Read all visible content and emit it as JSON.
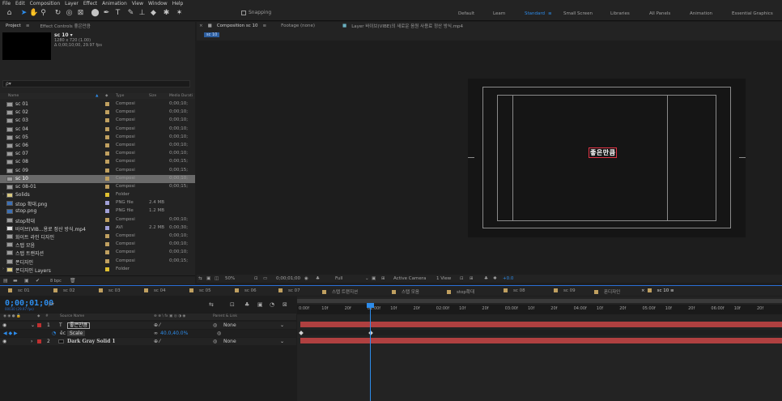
{
  "menu": [
    "File",
    "Edit",
    "Composition",
    "Layer",
    "Effect",
    "Animation",
    "View",
    "Window",
    "Help"
  ],
  "toolbar": {
    "snapping_label": "Snapping",
    "workspaces": [
      "Default",
      "Learn",
      "Standard",
      "Small Screen",
      "Libraries",
      "All Panels",
      "Animation",
      "Essential Graphics"
    ],
    "active_workspace": "Standard"
  },
  "project_panel": {
    "tab_project": "Project",
    "tab_effect": "Effect Controls 좋은만큼",
    "selected_name": "sc 10 ▾",
    "selected_info_1": "1280 x 720 (1.00)",
    "selected_info_2": "Δ 0;00;10;00, 29.97 fps",
    "search_placeholder": "ρ▾",
    "columns": {
      "name": "Name",
      "type": "Type",
      "size": "Size",
      "duration": "Media Durati"
    },
    "items": [
      {
        "name": "sc 01",
        "type": "Composi",
        "size": "",
        "duration": "0;00;10;",
        "icon": "comp",
        "label": "#c0a060"
      },
      {
        "name": "sc 02",
        "type": "Composi",
        "size": "",
        "duration": "0;00;10;",
        "icon": "comp",
        "label": "#c0a060"
      },
      {
        "name": "sc 03",
        "type": "Composi",
        "size": "",
        "duration": "0;00;10;",
        "icon": "comp",
        "label": "#c0a060"
      },
      {
        "name": "sc 04",
        "type": "Composi",
        "size": "",
        "duration": "0;00;10;",
        "icon": "comp",
        "label": "#c0a060"
      },
      {
        "name": "sc 05",
        "type": "Composi",
        "size": "",
        "duration": "0;00;10;",
        "icon": "comp",
        "label": "#c0a060"
      },
      {
        "name": "sc 06",
        "type": "Composi",
        "size": "",
        "duration": "0;00;10;",
        "icon": "comp",
        "label": "#c0a060"
      },
      {
        "name": "sc 07",
        "type": "Composi",
        "size": "",
        "duration": "0;00;10;",
        "icon": "comp",
        "label": "#c0a060"
      },
      {
        "name": "sc 08",
        "type": "Composi",
        "size": "",
        "duration": "0;00;15;",
        "icon": "comp",
        "label": "#c0a060"
      },
      {
        "name": "sc 09",
        "type": "Composi",
        "size": "",
        "duration": "0;00;15;",
        "icon": "comp",
        "label": "#c0a060"
      },
      {
        "name": "sc 10",
        "type": "Composi",
        "size": "",
        "duration": "0;00;10;",
        "icon": "comp",
        "label": "#c0a060",
        "selected": true
      },
      {
        "name": "sc 08-01",
        "type": "Composi",
        "size": "",
        "duration": "0;00;15;",
        "icon": "comp",
        "label": "#c0a060"
      },
      {
        "name": "Solids",
        "type": "Folder",
        "size": "",
        "duration": "",
        "icon": "folder",
        "label": "#e0c030",
        "twirl": true
      },
      {
        "name": "stop 확대.png",
        "type": "PNG file",
        "size": "2.4 MB",
        "duration": "",
        "icon": "png",
        "label": "#a0a0d8"
      },
      {
        "name": "stop.png",
        "type": "PNG file",
        "size": "1.2 MB",
        "duration": "",
        "icon": "png",
        "label": "#a0a0d8"
      },
      {
        "name": "stop확대",
        "type": "Composi",
        "size": "",
        "duration": "0;00;10;",
        "icon": "comp",
        "label": "#c0a060"
      },
      {
        "name": "바이브(VIB...용로 정산 방식.mp4",
        "type": "AVI",
        "size": "2.2 MB",
        "duration": "0;00;30;",
        "icon": "avi",
        "label": "#a0a0d8"
      },
      {
        "name": "화이트 라인 디자인",
        "type": "Composi",
        "size": "",
        "duration": "0;00;10;",
        "icon": "comp",
        "label": "#c0a060"
      },
      {
        "name": "스탭 모음",
        "type": "Composi",
        "size": "",
        "duration": "0;00;10;",
        "icon": "comp",
        "label": "#c0a060"
      },
      {
        "name": "스탭 트랜지션",
        "type": "Composi",
        "size": "",
        "duration": "0;00;10;",
        "icon": "comp",
        "label": "#c0a060"
      },
      {
        "name": "폰디자인",
        "type": "Composi",
        "size": "",
        "duration": "0;00;15;",
        "icon": "comp",
        "label": "#c0a060"
      },
      {
        "name": "폰디자인 Layers",
        "type": "Folder",
        "size": "",
        "duration": "",
        "icon": "folder",
        "label": "#e0c030",
        "twirl": true
      }
    ],
    "footer_bpc": "8 bpc"
  },
  "composition_panel": {
    "tab_comp": "Composition sc 10",
    "tab_footage": "Footage (none)",
    "tab_layer": "Layer 바이브(VIBE)의 새로운 음원 사용료 정산 방식.mp4",
    "subtab": "sc 10",
    "canvas_text": "좋은만큼",
    "footer": {
      "zoom": "50%",
      "time": "0;00;01;00",
      "resolution": "Full",
      "camera": "Active Camera",
      "views": "1 View",
      "exposure": "+0.0"
    }
  },
  "timeline": {
    "tabs": [
      {
        "label": "sc 01",
        "color": "#c0a060"
      },
      {
        "label": "sc 02",
        "color": "#c0a060"
      },
      {
        "label": "sc 03",
        "color": "#c0a060"
      },
      {
        "label": "sc 04",
        "color": "#c0a060"
      },
      {
        "label": "sc 05",
        "color": "#c0a060"
      },
      {
        "label": "sc 06",
        "color": "#c0a060"
      },
      {
        "label": "sc 07",
        "color": "#c0a060"
      },
      {
        "label": "스탭 트랜지션",
        "color": "#c0a060"
      },
      {
        "label": "스탭 모음",
        "color": "#c0a060"
      },
      {
        "label": "stop확대",
        "color": "#c0a060"
      },
      {
        "label": "sc 08",
        "color": "#c0a060"
      },
      {
        "label": "sc 09",
        "color": "#c0a060"
      },
      {
        "label": "폰디자인",
        "color": "#c0a060"
      },
      {
        "label": "sc 10",
        "color": "#c0a060",
        "active": true
      }
    ],
    "timecode": "0;00;01;00",
    "timecode_sub": "00030 (29.97 fps)",
    "search": "ρ▾",
    "columns": {
      "source": "Source Name",
      "parent": "Parent & Link"
    },
    "layers": [
      {
        "num": "1",
        "name": "좋은만큼",
        "parent": "None",
        "kind": "text",
        "label": "#c03030"
      },
      {
        "num": "2",
        "name": "Dark Gray Solid 1",
        "parent": "None",
        "kind": "solid",
        "label": "#c03030"
      }
    ],
    "scale_row": {
      "name": "Scale",
      "value": "40.0,40.0%"
    },
    "ruler": [
      "0:00f",
      "10f",
      "20f",
      "01:00f",
      "10f",
      "20f",
      "02:00f",
      "10f",
      "20f",
      "03:00f",
      "10f",
      "20f",
      "04:00f",
      "10f",
      "20f",
      "05:00f",
      "10f",
      "20f",
      "06:00f",
      "10f",
      "20f"
    ]
  },
  "colors": {
    "accent": "#2d8ceb",
    "layer_bar": "#b04040",
    "panel": "#232323",
    "bg": "#1d1d1d"
  }
}
